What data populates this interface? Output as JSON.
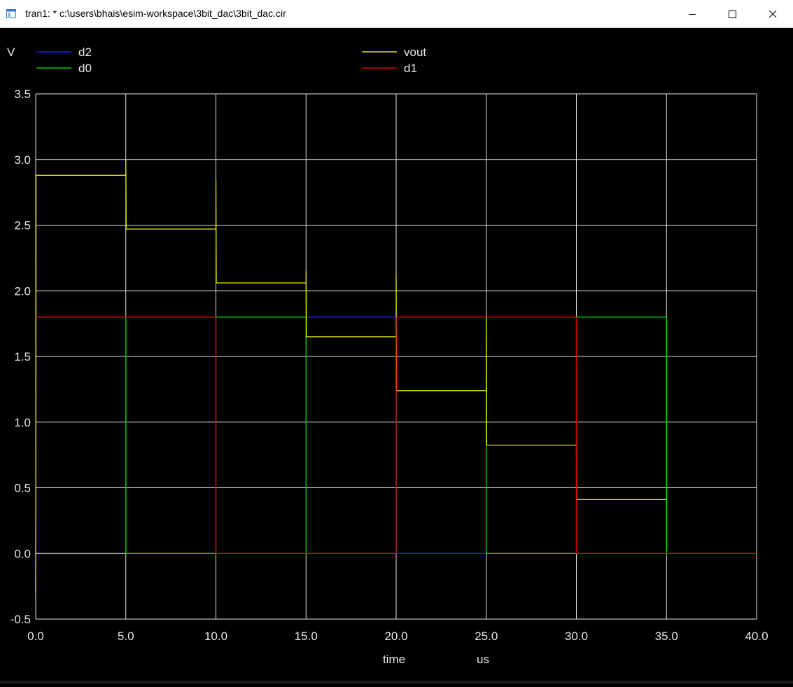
{
  "window": {
    "title": "tran1: * c:\\users\\bhais\\esim-workspace\\3bit_dac\\3bit_dac.cir",
    "icon": "app-window-icon",
    "controls": [
      "minimize-icon",
      "maximize-icon",
      "close-icon"
    ]
  },
  "colors": {
    "background": "#000000",
    "grid": "#e6e6e6",
    "text": "#e6e6e6",
    "d2": "#1e1ee6",
    "d0": "#00cc00",
    "vout": "#e6e600",
    "d1": "#dd0000"
  },
  "chart_data": {
    "type": "line",
    "ylabel": "V",
    "xlabel": "time",
    "xunit": "us",
    "xlim": [
      0,
      40
    ],
    "ylim": [
      -0.5,
      3.5
    ],
    "xticks": [
      0,
      5,
      10,
      15,
      20,
      25,
      30,
      35,
      40
    ],
    "xtick_labels": [
      "0.0",
      "5.0",
      "10.0",
      "15.0",
      "20.0",
      "25.0",
      "30.0",
      "35.0",
      "40.0"
    ],
    "yticks": [
      -0.5,
      0,
      0.5,
      1,
      1.5,
      2,
      2.5,
      3,
      3.5
    ],
    "ytick_labels": [
      "-0.5",
      "0.0",
      "0.5",
      "1.0",
      "1.5",
      "2.0",
      "2.5",
      "3.0",
      "3.5"
    ],
    "grid": true,
    "legend_placement": "top",
    "series": [
      {
        "name": "d2",
        "color_key": "d2",
        "x": [
          0,
          20,
          20,
          25,
          25,
          40
        ],
        "y": [
          1.8,
          1.8,
          0,
          0,
          0,
          0
        ]
      },
      {
        "name": "d0",
        "color_key": "d0",
        "x": [
          0,
          5,
          5,
          10,
          10,
          15,
          15,
          20,
          20,
          25,
          25,
          30,
          30,
          35,
          35,
          40
        ],
        "y": [
          1.8,
          1.8,
          0,
          0,
          1.8,
          1.8,
          0,
          0,
          1.8,
          1.8,
          0,
          0,
          1.8,
          1.8,
          0,
          0
        ]
      },
      {
        "name": "vout",
        "color_key": "vout",
        "x": [
          0,
          0.02,
          5,
          5,
          5.02,
          10,
          10,
          10.02,
          15,
          15,
          15.02,
          20,
          20,
          20.02,
          25,
          25,
          25.02,
          30,
          30,
          30.02,
          35
        ],
        "y": [
          -0.3,
          2.88,
          2.88,
          3.0,
          2.47,
          2.47,
          2.85,
          2.06,
          2.06,
          2.15,
          1.65,
          1.65,
          2.12,
          1.24,
          1.24,
          1.8,
          0.825,
          0.825,
          0.825,
          0.41,
          0.41
        ]
      },
      {
        "name": "d1",
        "color_key": "d1",
        "x": [
          0,
          5,
          5,
          10,
          10,
          15,
          15,
          20,
          20,
          25,
          25,
          30,
          30,
          35,
          35,
          40
        ],
        "y": [
          1.8,
          1.8,
          1.8,
          1.8,
          0,
          0,
          0,
          0,
          1.8,
          1.8,
          1.8,
          1.8,
          0,
          0,
          0,
          0
        ]
      }
    ]
  }
}
